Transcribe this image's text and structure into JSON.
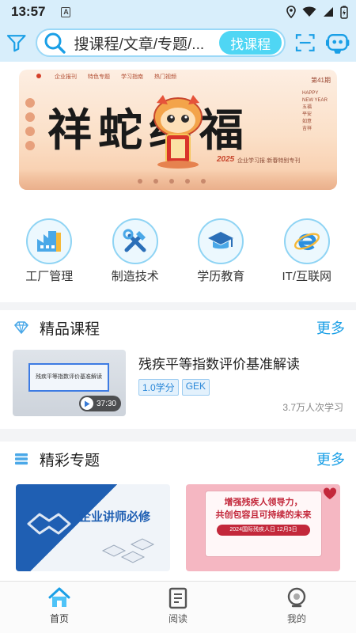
{
  "status": {
    "time": "13:57",
    "badge": "A"
  },
  "search": {
    "placeholder": "搜课程/文章/专题/...",
    "button": "找课程"
  },
  "banner": {
    "title": "祥蛇纳福",
    "header_tabs": [
      "企业报刊",
      "特色专题",
      "学习指南",
      "热门视频"
    ],
    "issue": "第41期",
    "side_text": [
      "HAPPY NEW YEAR",
      "五福",
      "平安",
      "如意",
      "吉祥"
    ],
    "year": "2025",
    "subtitle": "企业学习报·新春特别专刊"
  },
  "categories": [
    {
      "label": "工厂管理",
      "icon": "factory-icon"
    },
    {
      "label": "制造技术",
      "icon": "tools-icon"
    },
    {
      "label": "学历教育",
      "icon": "graduation-cap-icon"
    },
    {
      "label": "IT/互联网",
      "icon": "browser-e-icon"
    }
  ],
  "courses_section": {
    "title": "精品课程",
    "more": "更多",
    "course": {
      "title": "残疾平等指数评价基准解读",
      "thumb_text": "残疾平等指数评价基准解读",
      "duration": "37:30",
      "tags": [
        "1.0学分",
        "GEK"
      ],
      "learners": "3.7万人次学习"
    }
  },
  "topics_section": {
    "title": "精彩专题",
    "more": "更多",
    "cards": [
      {
        "title": "企业讲师必修"
      },
      {
        "lines": [
          "增强残疾人领导力，",
          "共创包容且可持续的未来"
        ],
        "pill": "2024国际残疾人日 12月3日"
      }
    ]
  },
  "tabbar": [
    {
      "label": "首页",
      "icon": "home-icon",
      "active": true
    },
    {
      "label": "阅读",
      "icon": "book-icon",
      "active": false
    },
    {
      "label": "我的",
      "icon": "profile-icon",
      "active": false
    }
  ],
  "colors": {
    "accent": "#1a9fe6",
    "header_bg": "#d8eefb",
    "search_button": "#4fd6f4"
  }
}
